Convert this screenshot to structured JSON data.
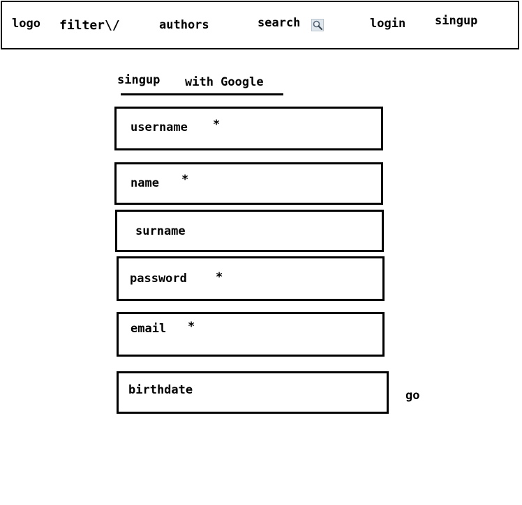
{
  "header": {
    "logo": "logo",
    "filter": "filter\\/",
    "authors": "authors",
    "search": "search",
    "login": "login",
    "signup": "singup"
  },
  "form": {
    "signup_tab": "singup",
    "google_tab": "with Google",
    "fields": {
      "username": "username",
      "name": "name",
      "surname": "surname",
      "password": "password",
      "email": "email",
      "birthdate": "birthdate"
    },
    "required_mark": "*",
    "go": "go"
  },
  "icons": {
    "search": "magnifier-icon"
  }
}
